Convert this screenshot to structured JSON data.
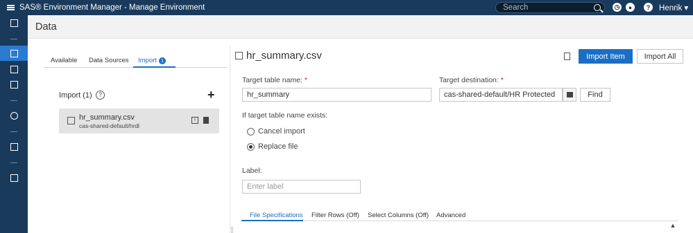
{
  "app": {
    "title": "SAS® Environment Manager - Manage Environment",
    "search_placeholder": "Search",
    "user_label": "Henrik ▾"
  },
  "nav": {
    "items": [
      "reports-icon",
      "data-icon",
      "servers-icon",
      "content-icon",
      "settings-icon",
      "jobs-icon",
      "users-icon"
    ]
  },
  "page": {
    "title": "Data"
  },
  "left": {
    "tabs": [
      "Available",
      "Data Sources",
      "Import"
    ],
    "import_badge": "1",
    "import_header": "Import (1)",
    "file": {
      "name": "hr_summary.csv",
      "path": "cas-shared-default/hrdl"
    }
  },
  "right": {
    "title": "hr_summary.csv",
    "import_item_label": "Import Item",
    "import_all_label": "Import All",
    "target_table_label": "Target table name:",
    "target_table_value": "hr_summary",
    "target_dest_label": "Target destination:",
    "target_dest_value": "cas-shared-default/HR Protected",
    "find_label": "Find",
    "exists_label": "If target table name exists:",
    "option_cancel": "Cancel import",
    "option_replace": "Replace file",
    "selected_option": "Replace file",
    "label_label": "Label:",
    "label_placeholder": "Enter label",
    "tabs": [
      "File Specifications",
      "Filter Rows (Off)",
      "Select Columns (Off)",
      "Advanced"
    ]
  },
  "colors": {
    "accent": "#1a6fc4",
    "nav_bg": "#1a3a5c",
    "nav_active": "#2b7bd0"
  }
}
